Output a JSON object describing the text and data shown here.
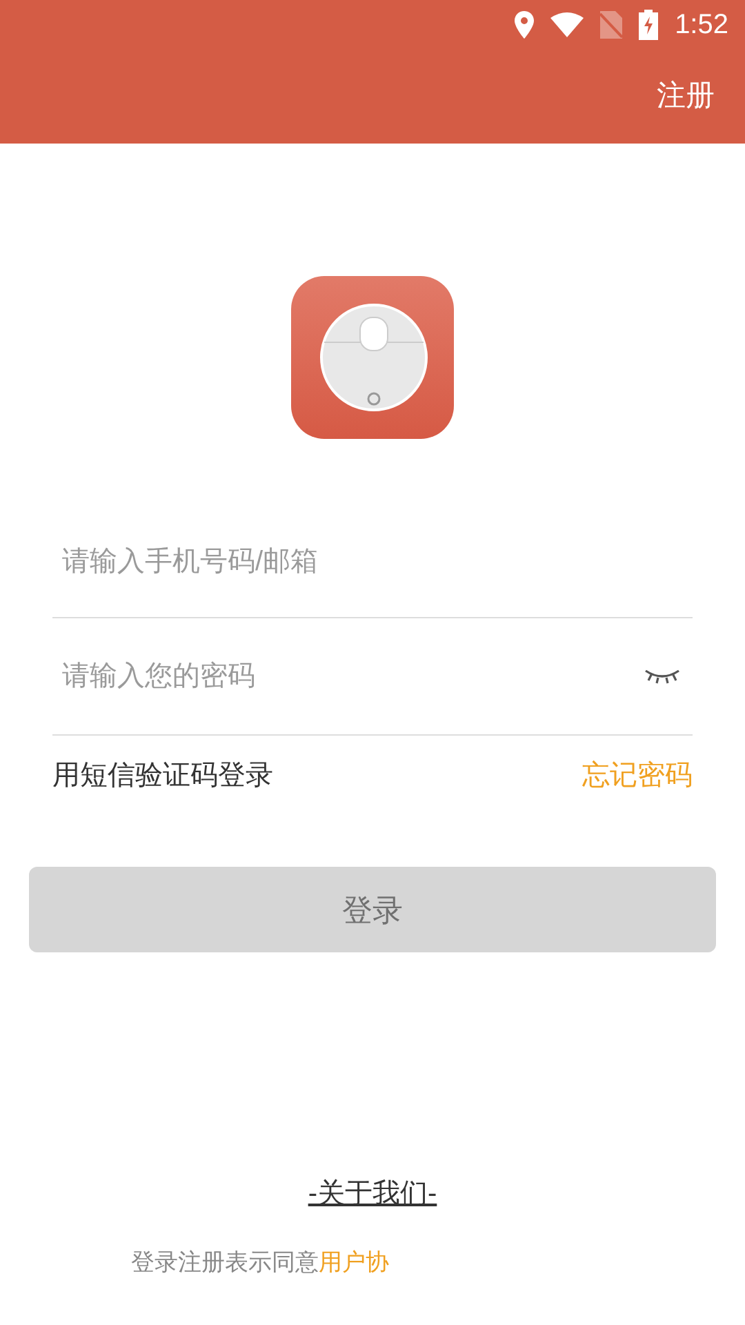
{
  "status_bar": {
    "time": "1:52"
  },
  "header": {
    "action": "注册"
  },
  "form": {
    "account_placeholder": "请输入手机号码/邮箱",
    "password_placeholder": "请输入您的密码",
    "sms_login": "用短信验证码登录",
    "forgot_password": "忘记密码"
  },
  "login_button": {
    "label": "登录",
    "disabled": true
  },
  "footer": {
    "about": "-关于我们-",
    "agreement_text": "登录注册表示同意",
    "agreement_link": "用户协"
  }
}
